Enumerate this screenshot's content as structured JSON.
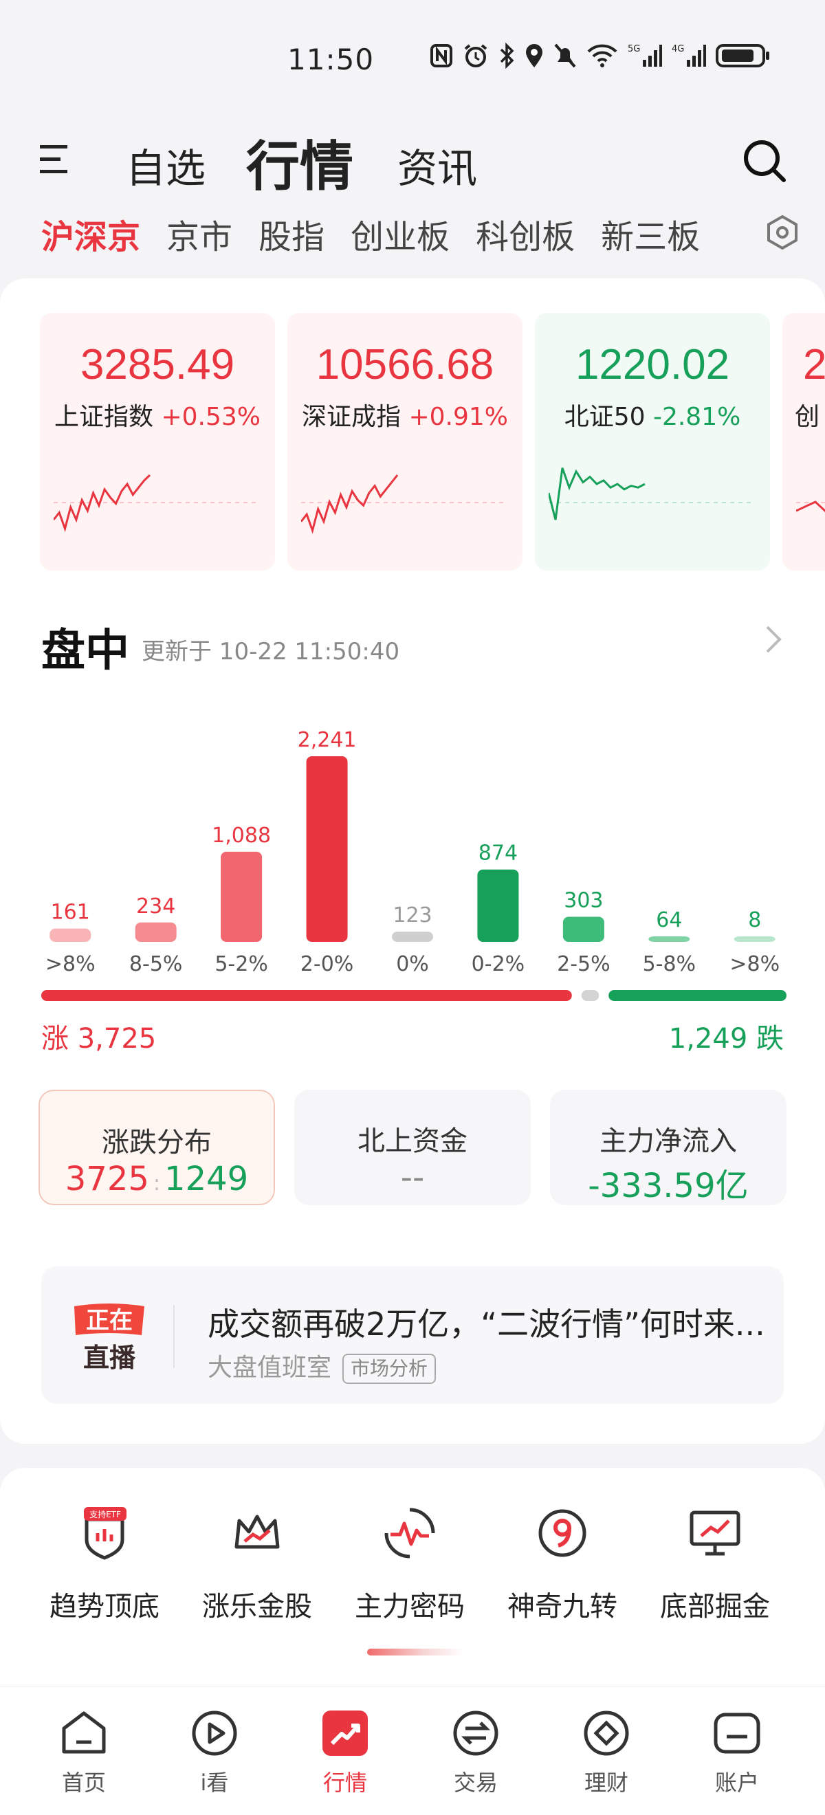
{
  "status_bar": {
    "time": "11:50"
  },
  "top_nav": {
    "tab_watchlist": "自选",
    "tab_market": "行情",
    "tab_news": "资讯"
  },
  "sub_tabs": [
    "沪深京",
    "京市",
    "股指",
    "创业板",
    "科创板",
    "新三板"
  ],
  "indices": [
    {
      "value": "3285.49",
      "name": "上证指数",
      "change": "+0.53%",
      "trend": "up",
      "spark": [
        30,
        38,
        20,
        44,
        30,
        52,
        40,
        60,
        46,
        64,
        55,
        48,
        62,
        70,
        58,
        66,
        74,
        80
      ]
    },
    {
      "value": "10566.68",
      "name": "深证成指",
      "change": "+0.91%",
      "trend": "up",
      "spark": [
        28,
        36,
        18,
        42,
        28,
        50,
        38,
        58,
        44,
        62,
        52,
        46,
        60,
        68,
        56,
        64,
        72,
        80
      ]
    },
    {
      "value": "1220.02",
      "name": "北证50",
      "change": "-2.81%",
      "trend": "down",
      "spark": [
        60,
        30,
        88,
        66,
        84,
        72,
        78,
        70,
        74,
        66,
        70,
        64,
        68,
        66,
        70
      ]
    },
    {
      "value": "2",
      "name": "创",
      "change": "",
      "trend": "up",
      "spark": [
        40,
        50,
        30,
        56,
        44,
        60
      ]
    }
  ],
  "session": {
    "title": "盘中",
    "updated": "更新于 10-22 11:50:40"
  },
  "chart_data": {
    "type": "bar",
    "categories": [
      ">8%",
      "8-5%",
      "5-2%",
      "2-0%",
      "0%",
      "0-2%",
      "2-5%",
      "5-8%",
      ">8%"
    ],
    "values": [
      161,
      234,
      1088,
      2241,
      123,
      874,
      303,
      64,
      8
    ],
    "value_labels": [
      "161",
      "234",
      "1,088",
      "2,241",
      "123",
      "874",
      "303",
      "64",
      "8"
    ],
    "colors": [
      "#f9b4b8",
      "#f58c92",
      "#f0656e",
      "#e8353f",
      "#cfcfcf",
      "#16a05a",
      "#3dbb78",
      "#7fd3a5",
      "#b8e6cc"
    ],
    "label_colors": [
      "#e8353f",
      "#e8353f",
      "#e8353f",
      "#e8353f",
      "#999999",
      "#16a05a",
      "#16a05a",
      "#16a05a",
      "#16a05a"
    ],
    "ylim": [
      0,
      2241
    ]
  },
  "breadth": {
    "up_label": "涨 3,725",
    "down_label": "1,249 跌",
    "up": 3725,
    "flat": 123,
    "down": 1249
  },
  "stats": {
    "dist": {
      "title": "涨跌分布",
      "up": "3725",
      "down": "1249"
    },
    "north": {
      "title": "北上资金",
      "value": "--"
    },
    "main": {
      "title": "主力净流入",
      "value": "-333.59亿"
    }
  },
  "live": {
    "badge_top": "正在",
    "badge_bottom": "直播",
    "title": "成交额再破2万亿，“二波行情”何时来...",
    "source": "大盘值班室",
    "tag": "市场分析"
  },
  "tools": [
    {
      "label": "趋势顶底",
      "badge": "支持ETF",
      "icon": "shield-chart-icon"
    },
    {
      "label": "涨乐金股",
      "icon": "crown-icon"
    },
    {
      "label": "主力密码",
      "icon": "pulse-icon"
    },
    {
      "label": "神奇九转",
      "icon": "nine-icon"
    },
    {
      "label": "底部掘金",
      "icon": "monitor-chart-icon"
    }
  ],
  "bottom_tabs": [
    {
      "label": "首页",
      "icon": "home-icon"
    },
    {
      "label": "i看",
      "icon": "play-icon"
    },
    {
      "label": "行情",
      "icon": "market-icon"
    },
    {
      "label": "交易",
      "icon": "exchange-icon"
    },
    {
      "label": "理财",
      "icon": "diamond-icon"
    },
    {
      "label": "账户",
      "icon": "account-icon"
    }
  ],
  "colors": {
    "up": "#e8353f",
    "down": "#16a05a",
    "flat": "#cfcfcf",
    "accent": "#e8353f"
  }
}
